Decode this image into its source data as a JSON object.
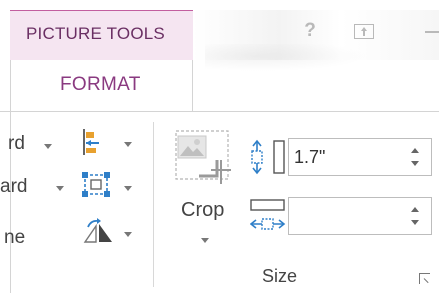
{
  "contextual_tab": {
    "group_label": "PICTURE TOOLS"
  },
  "tabs": [
    {
      "label": "FORMAT",
      "active": true
    }
  ],
  "window_controls": {
    "help_label": "?"
  },
  "arrange": {
    "rows": [
      {
        "label_fragment": "rd"
      },
      {
        "label_fragment": "ard"
      },
      {
        "label_fragment": "ne"
      }
    ]
  },
  "size_group": {
    "crop_label": "Crop",
    "height_value": "1.7\"",
    "width_value": "",
    "group_label": "Size"
  },
  "colors": {
    "contextual_band": "#f5e5f1",
    "contextual_accent": "#c25e9f",
    "contextual_text": "#6a2f63",
    "tab_text": "#8a3a80",
    "icon_blue": "#2f7fc8",
    "icon_orange": "#e8a12f"
  },
  "icons": [
    "help-icon",
    "ribbon-display-icon",
    "minimize-icon",
    "bring-forward-icon",
    "send-backward-icon",
    "selection-pane-icon",
    "align-icon",
    "group-icon",
    "rotate-icon",
    "crop-icon",
    "shape-height-icon",
    "shape-width-icon",
    "dialog-launcher-icon"
  ]
}
